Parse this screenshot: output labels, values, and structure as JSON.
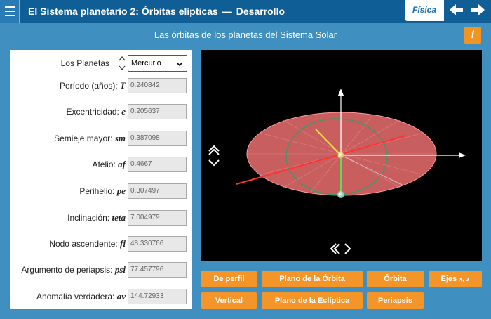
{
  "header": {
    "title": "El Sistema planetario 2: Órbitas elípticas",
    "separator": "—",
    "section": "Desarrollo",
    "subject_tab": "Física"
  },
  "subtitle": "Las órbitas de los planetas del Sistema Solar",
  "info_label": "i",
  "panel": {
    "planet_label": "Los Planetas",
    "planet_selected": "Mercurio",
    "params": [
      {
        "label": "Período (años):",
        "symbol": "T",
        "value": "0.240842"
      },
      {
        "label": "Excentricidad:",
        "symbol": "e",
        "value": "0.205637"
      },
      {
        "label": "Semieje mayor:",
        "symbol": "sm",
        "value": "0.387098"
      },
      {
        "label": "Afelio:",
        "symbol": "af",
        "value": "0.4667"
      },
      {
        "label": "Perihelio:",
        "symbol": "pe",
        "value": "0.307497"
      },
      {
        "label": "Inclinación:",
        "symbol": "teta",
        "value": "7.004979"
      },
      {
        "label": "Nodo ascendente:",
        "symbol": "fi",
        "value": "48.330766"
      },
      {
        "label": "Argumento de periapsis:",
        "symbol": "psi",
        "value": "77.457796"
      },
      {
        "label": "Anomalía verdadera:",
        "symbol": "av",
        "value": "144.72933"
      }
    ]
  },
  "buttons": {
    "de_perfil": "De perfil",
    "plano_orbita": "Plano de la Órbita",
    "orbita": "Órbita",
    "ejes_prefix": "Ejes",
    "ejes_symbols": "x, z",
    "vertical": "Vertical",
    "plano_ecliptica": "Plano de la Eclíptica",
    "periapsis": "Periapsis"
  },
  "colors": {
    "topbar": "#0f5f96",
    "background": "#3f8fc1",
    "accent": "#f4952a",
    "orbit_disc": "#e07070"
  },
  "icons": {
    "menu": "hamburger-icon",
    "prev": "arrow-left-icon",
    "next": "arrow-right-icon",
    "rotate_vertical": "double-chevron-updown-icon",
    "rotate_horizontal": "double-chevron-leftright-icon"
  }
}
